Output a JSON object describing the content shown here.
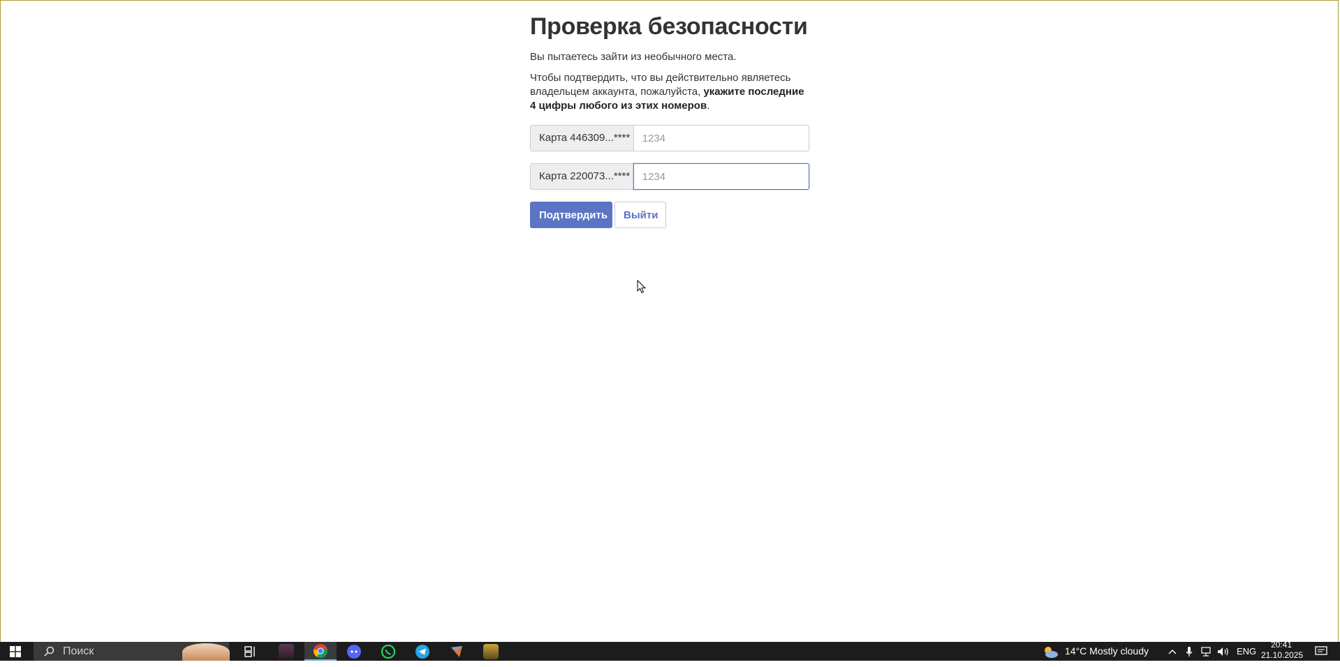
{
  "page": {
    "title": "Проверка безопасности",
    "intro": "Вы пытаетесь зайти из необычного места.",
    "instruction_prefix": "Чтобы подтвердить, что вы действительно являетесь владельцем аккаунта, пожалуйста, ",
    "instruction_bold": "укажите последние 4 цифры любого из этих номеров",
    "instruction_suffix": "."
  },
  "cards": [
    {
      "label": "Карта 446309...****",
      "value": "",
      "placeholder": "1234",
      "focused": false
    },
    {
      "label": "Карта 220073...****",
      "value": "",
      "placeholder": "1234",
      "focused": true
    }
  ],
  "buttons": {
    "confirm": "Подтвердить",
    "logout": "Выйти"
  },
  "taskbar": {
    "search_placeholder": "Поиск",
    "apps": [
      "task-view-icon",
      "game-app-icon",
      "chrome-icon",
      "discord-icon",
      "whatsapp-icon",
      "telegram-icon",
      "app-icon",
      "game-launcher-icon"
    ],
    "weather": "14°C  Mostly cloudy",
    "language": "ENG",
    "time": "20:41",
    "date": "21.10.2025"
  },
  "colors": {
    "accent": "#5b74c4",
    "addon_bg": "#eeeeee",
    "taskbar_bg": "#1c1c1c"
  }
}
